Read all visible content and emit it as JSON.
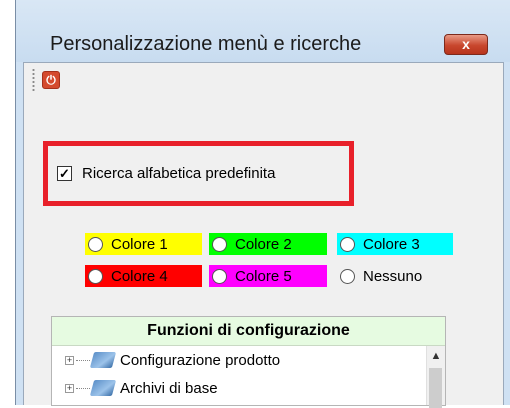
{
  "window": {
    "title": "Personalizzazione menù e ricerche",
    "close_label": "x"
  },
  "toolbar": {
    "power_icon": "power-icon"
  },
  "options": {
    "alpha_search_label": "Ricerca alfabetica predefinita",
    "alpha_search_checked": true
  },
  "colors": [
    {
      "label": "Colore 1",
      "bg": "#ffff00"
    },
    {
      "label": "Colore 2",
      "bg": "#00ff00"
    },
    {
      "label": "Colore 3",
      "bg": "#00ffff"
    },
    {
      "label": "Colore 4",
      "bg": "#ff0000"
    },
    {
      "label": "Colore 5",
      "bg": "#ff00ff"
    },
    {
      "label": "Nessuno",
      "bg": "transparent"
    }
  ],
  "panel": {
    "header": "Funzioni di configurazione",
    "items": [
      {
        "label": "Configurazione prodotto"
      },
      {
        "label": "Archivi di base"
      }
    ]
  },
  "theme": {
    "highlight": "#e8202a",
    "header_bg": "#e6fbe1"
  }
}
